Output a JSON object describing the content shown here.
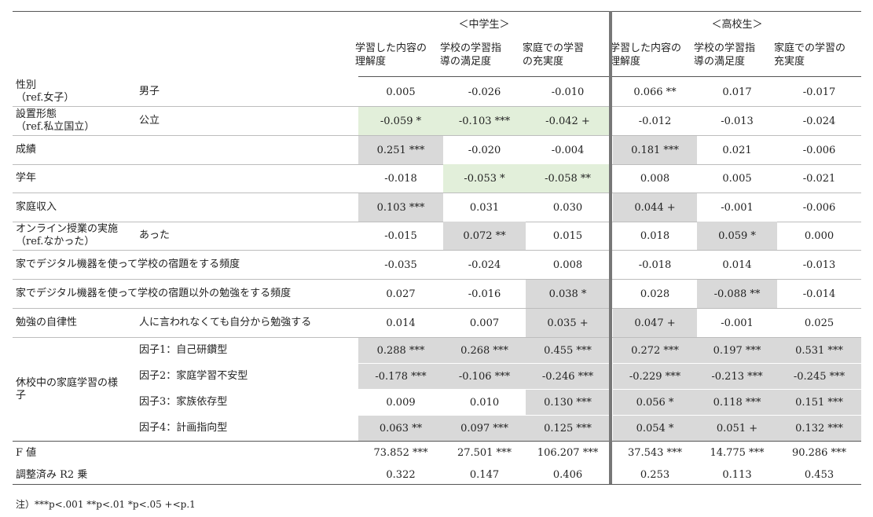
{
  "groups": {
    "middle": "＜中学生＞",
    "high": "＜高校生＞"
  },
  "columns": [
    "学習した内容の\n理解度",
    "学校の学習指\n導の満足度",
    "家庭での学習\nの充実度",
    "学習した内容の\n理解度",
    "学校の学習指\n導の満足度",
    "家庭での学習の\n充実度"
  ],
  "rows": [
    {
      "label": "性別\n（ref.女子）",
      "sub": "男子",
      "values": [
        "0.005",
        "-0.026",
        "-0.010",
        "0.066 **",
        "0.017",
        "-0.017"
      ],
      "hl": [
        "",
        "",
        "",
        "",
        "",
        ""
      ]
    },
    {
      "label": "設置形態\n（ref.私立国立）",
      "sub": "公立",
      "values": [
        "-0.059 *",
        "-0.103 ***",
        "-0.042 +",
        "-0.012",
        "-0.013",
        "-0.024"
      ],
      "hl": [
        "g",
        "g",
        "g",
        "",
        "",
        ""
      ]
    },
    {
      "label": "成績",
      "sub": "",
      "values": [
        "0.251 ***",
        "-0.020",
        "-0.004",
        "0.181 ***",
        "0.021",
        "-0.006"
      ],
      "hl": [
        "d",
        "",
        "",
        "d",
        "",
        ""
      ]
    },
    {
      "label": "学年",
      "sub": "",
      "values": [
        "-0.018",
        "-0.053 *",
        "-0.058 **",
        "0.008",
        "0.005",
        "-0.021"
      ],
      "hl": [
        "",
        "g",
        "g",
        "",
        "",
        ""
      ]
    },
    {
      "label": "家庭収入",
      "sub": "",
      "values": [
        "0.103 ***",
        "0.031",
        "0.030",
        "0.044 +",
        "-0.001",
        "-0.006"
      ],
      "hl": [
        "d",
        "",
        "",
        "d",
        "",
        ""
      ]
    },
    {
      "label": "オンライン授業の実施\n（ref.なかった）",
      "sub": "あった",
      "values": [
        "-0.015",
        "0.072 **",
        "0.015",
        "0.018",
        "0.059 *",
        "0.000"
      ],
      "hl": [
        "",
        "d",
        "",
        "",
        "d",
        ""
      ]
    },
    {
      "label": "家でデジタル機器を使って学校の宿題をする頻度",
      "sub": "",
      "values": [
        "-0.035",
        "-0.024",
        "0.008",
        "-0.018",
        "0.014",
        "-0.013"
      ],
      "hl": [
        "",
        "",
        "",
        "",
        "",
        ""
      ]
    },
    {
      "label": "家でデジタル機器を使って学校の宿題以外の勉強をする頻度",
      "sub": "",
      "values": [
        "0.027",
        "-0.016",
        "0.038 *",
        "0.028",
        "-0.088 **",
        "-0.014"
      ],
      "hl": [
        "",
        "",
        "d",
        "",
        "d",
        ""
      ]
    },
    {
      "label": "勉強の自律性",
      "sub": "人に言われなくても自分から勉強する",
      "values": [
        "0.014",
        "0.007",
        "0.035 +",
        "0.047 +",
        "-0.001",
        "0.025"
      ],
      "hl": [
        "",
        "",
        "d",
        "d",
        "",
        ""
      ]
    }
  ],
  "factor_group": {
    "label": "休校中の家庭学習の様\n子",
    "rows": [
      {
        "sub": "因子1：自己研鑽型",
        "values": [
          "0.288 ***",
          "0.268 ***",
          "0.455 ***",
          "0.272 ***",
          "0.197 ***",
          "0.531 ***"
        ],
        "hl": [
          "d",
          "d",
          "d",
          "d",
          "d",
          "d"
        ]
      },
      {
        "sub": "因子2：家庭学習不安型",
        "values": [
          "-0.178 ***",
          "-0.106 ***",
          "-0.246 ***",
          "-0.229 ***",
          "-0.213 ***",
          "-0.245 ***"
        ],
        "hl": [
          "d",
          "d",
          "d",
          "d",
          "d",
          "d"
        ]
      },
      {
        "sub": "因子3：家族依存型",
        "values": [
          "0.009",
          "0.010",
          "0.130 ***",
          "0.056 *",
          "0.118 ***",
          "0.151 ***"
        ],
        "hl": [
          "",
          "",
          "d",
          "d",
          "d",
          "d"
        ]
      },
      {
        "sub": "因子4：計画指向型",
        "values": [
          "0.063 **",
          "0.097 ***",
          "0.125 ***",
          "0.054 *",
          "0.051 +",
          "0.132 ***"
        ],
        "hl": [
          "d",
          "d",
          "d",
          "d",
          "d",
          "d"
        ]
      }
    ]
  },
  "stats": [
    {
      "label": "F 値",
      "values": [
        "73.852 ***",
        "27.501 ***",
        "106.207 ***",
        "37.543 ***",
        "14.775 ***",
        "90.286 ***"
      ]
    },
    {
      "label": "調整済み R2 乗",
      "values": [
        "0.322",
        "0.147",
        "0.406",
        "0.253",
        "0.113",
        "0.453"
      ]
    }
  ],
  "note": "注）***p<.001 **p<.01 *p<.05 +<p.1",
  "colors": {
    "gray": "#d9d9d9",
    "green": "#e2efda",
    "divider": "#777777"
  }
}
